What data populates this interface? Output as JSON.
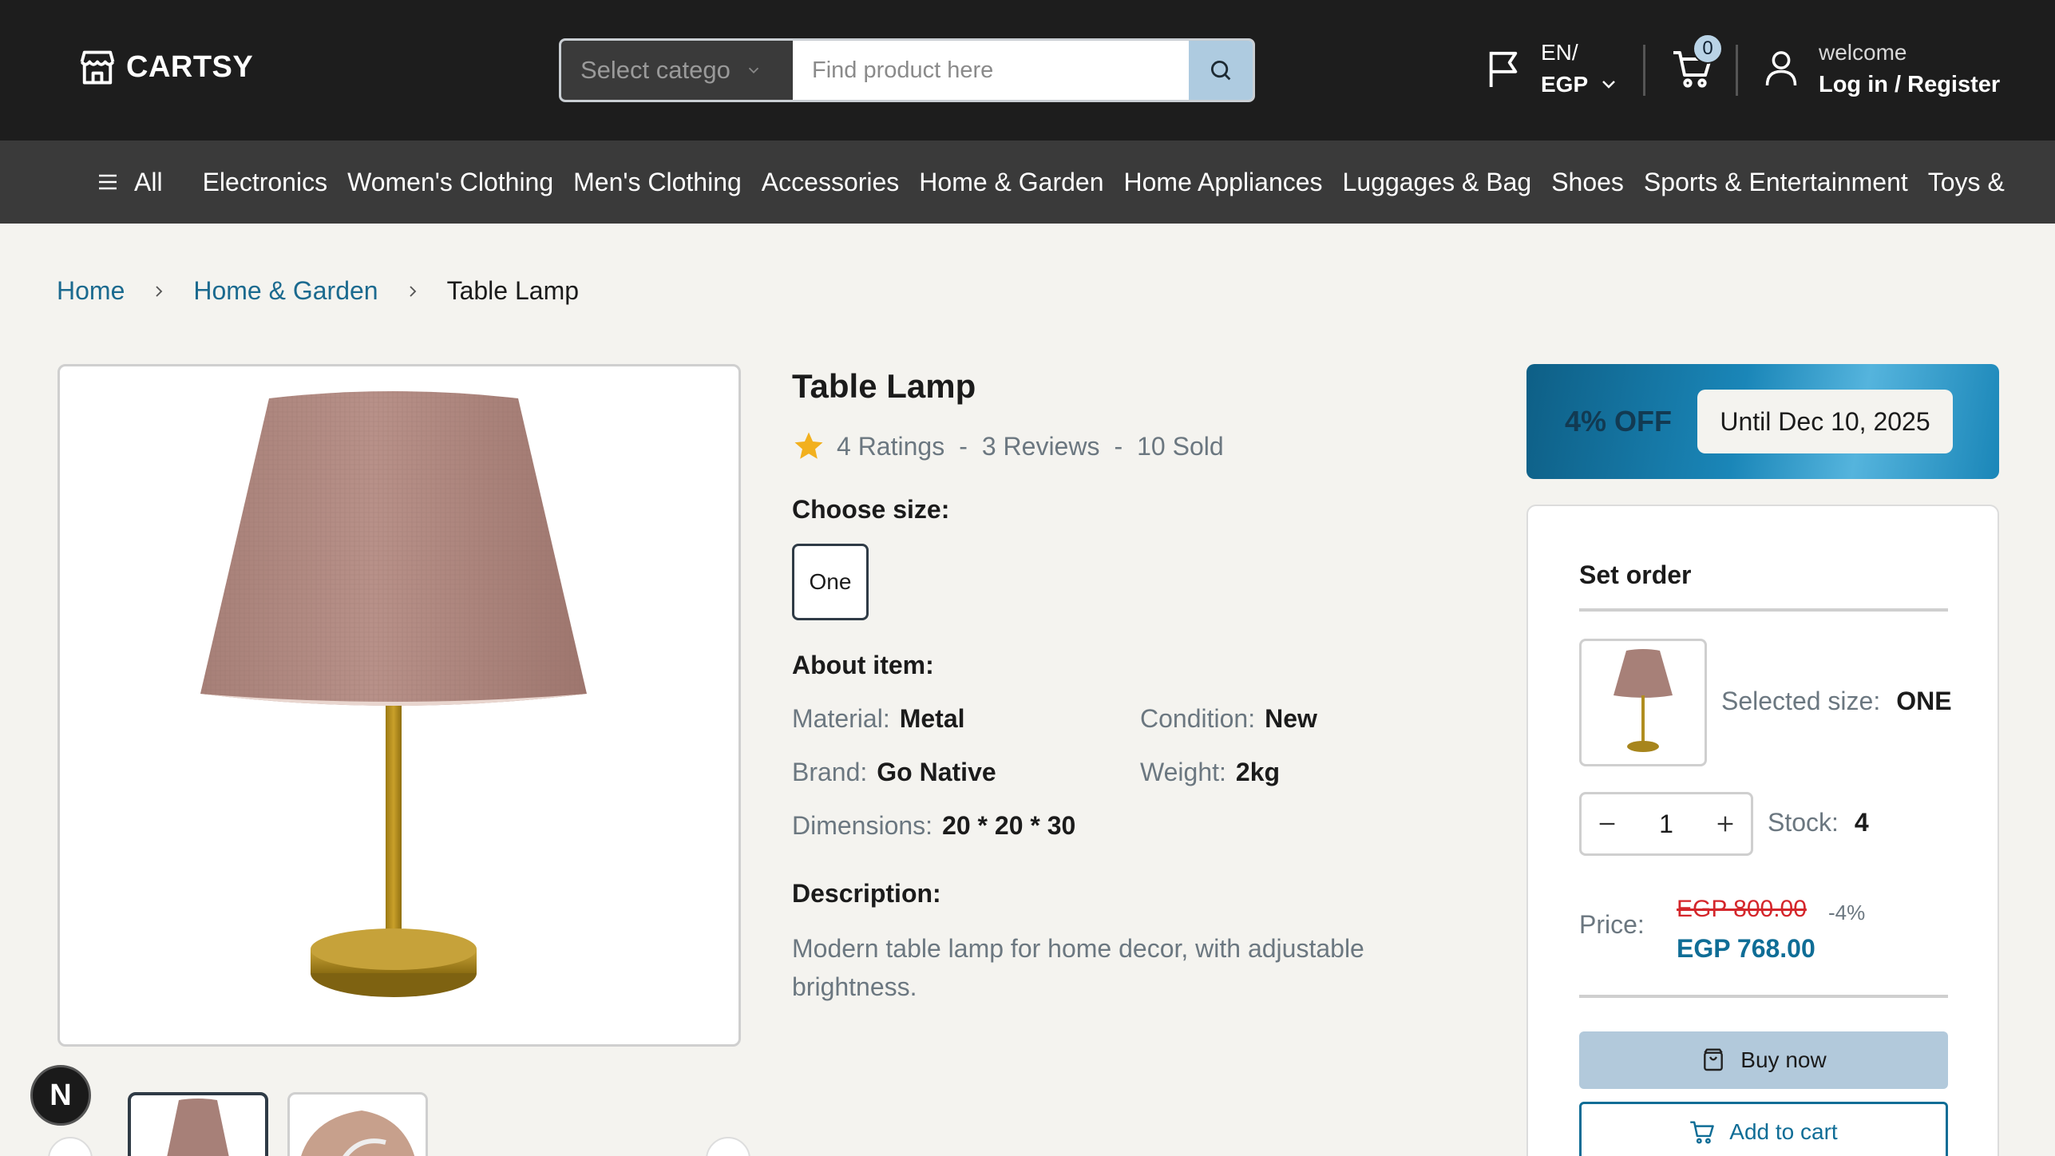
{
  "header": {
    "logo_text": "CARTSY",
    "search": {
      "category_placeholder": "Select catego",
      "input_placeholder": "Find product here"
    },
    "lang": {
      "language": "EN/",
      "currency": "EGP"
    },
    "cart_count": "0",
    "account": {
      "welcome": "welcome",
      "login": "Log in / Register"
    }
  },
  "nav": {
    "all_label": "All",
    "categories": [
      "Electronics",
      "Women's Clothing",
      "Men's Clothing",
      "Accessories",
      "Home & Garden",
      "Home Appliances",
      "Luggages & Bag",
      "Shoes",
      "Sports & Entertainment",
      "Toys &"
    ]
  },
  "breadcrumb": {
    "home": "Home",
    "category": "Home & Garden",
    "current": "Table Lamp"
  },
  "product": {
    "title": "Table Lamp",
    "ratings": "4 Ratings",
    "reviews": "3 Reviews",
    "sold": "10 Sold",
    "separator": "-",
    "choose_size_label": "Choose size:",
    "size_option": "One",
    "about_label": "About item:",
    "attributes": {
      "material_label": "Material:",
      "material": "Metal",
      "condition_label": "Condition:",
      "condition": "New",
      "brand_label": "Brand:",
      "brand": "Go Native",
      "weight_label": "Weight:",
      "weight": "2kg",
      "dimensions_label": "Dimensions:",
      "dimensions": "20 * 20 * 30"
    },
    "description_label": "Description:",
    "description": "Modern table lamp for home decor, with adjustable brightness."
  },
  "discount": {
    "percent": "4% OFF",
    "until": "Until Dec 10, 2025"
  },
  "order": {
    "title": "Set order",
    "selected_size_label": "Selected size:",
    "selected_size": "ONE",
    "quantity": "1",
    "stock_label": "Stock:",
    "stock": "4",
    "price_label": "Price:",
    "old_price": "EGP 800.00",
    "discount_pct": "-4%",
    "new_price": "EGP 768.00",
    "buy_now": "Buy now",
    "add_to_cart": "Add to cart"
  },
  "dev_badge": "N",
  "colors": {
    "header_bg": "#1d1d1d",
    "nav_bg": "#3a3a3a",
    "accent": "#0f6d96",
    "old_price": "#d4262b",
    "star": "#f2b01e"
  }
}
